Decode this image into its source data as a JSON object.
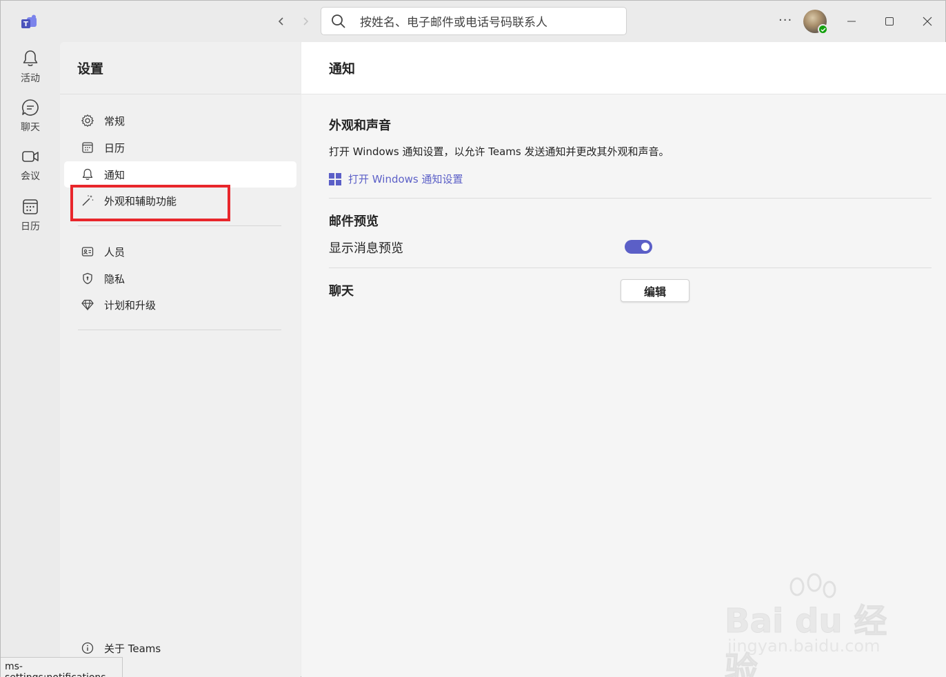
{
  "titlebar": {
    "search_placeholder": "按姓名、电子邮件或电话号码联系人",
    "more_label": "···"
  },
  "rail": {
    "items": [
      {
        "label": "活动",
        "icon": "bell-icon"
      },
      {
        "label": "聊天",
        "icon": "chat-icon"
      },
      {
        "label": "会议",
        "icon": "video-icon"
      },
      {
        "label": "日历",
        "icon": "calendar-icon"
      }
    ]
  },
  "settings": {
    "title": "设置",
    "items": [
      {
        "label": "常规",
        "icon": "gear-icon"
      },
      {
        "label": "日历",
        "icon": "calendar-icon"
      },
      {
        "label": "通知",
        "icon": "bell-icon",
        "active": true
      },
      {
        "label": "外观和辅助功能",
        "icon": "magic-wand-icon"
      },
      {
        "label": "人员",
        "icon": "contact-card-icon"
      },
      {
        "label": "隐私",
        "icon": "shield-icon"
      },
      {
        "label": "计划和升级",
        "icon": "diamond-icon"
      }
    ],
    "about_label": "关于 Teams"
  },
  "status_tip": "ms-settings:notifications",
  "main": {
    "title": "通知",
    "appearance_section": {
      "title": "外观和声音",
      "description": "打开 Windows 通知设置，以允许 Teams 发送通知并更改其外观和声音。",
      "link_label": "打开 Windows 通知设置"
    },
    "email_section": {
      "title": "邮件预览",
      "toggle_label": "显示消息预览",
      "toggle_on": true
    },
    "chat_section": {
      "title": "聊天",
      "edit_label": "编辑"
    }
  },
  "watermark": {
    "brand": "Bai du 经验",
    "url": "jingyan.baidu.com"
  },
  "colors": {
    "accent": "#5b5fc7",
    "highlight": "#e8262b",
    "presence": "#13a10e"
  }
}
